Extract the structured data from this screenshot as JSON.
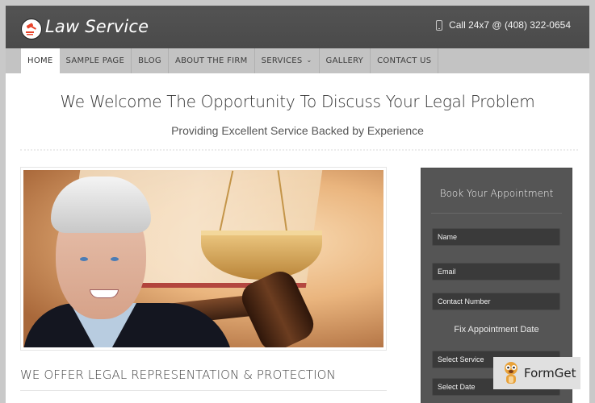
{
  "header": {
    "logo_icon": "gavel-icon",
    "site_title": "Law Service",
    "phone_icon": "mobile-phone-icon",
    "phone_text": "Call 24x7 @ (408) 322-0654"
  },
  "nav": {
    "items": [
      {
        "label": "HOME",
        "active": true
      },
      {
        "label": "SAMPLE PAGE"
      },
      {
        "label": "BLOG"
      },
      {
        "label": "ABOUT THE FIRM"
      },
      {
        "label": "SERVICES",
        "dropdown": true
      },
      {
        "label": "GALLERY"
      },
      {
        "label": "CONTACT US"
      }
    ]
  },
  "main": {
    "headline": "We Welcome The Opportunity To Discuss Your Legal Problem",
    "subheadline": "Providing Excellent Service Backed by Experience",
    "hero_image": "lawyer-with-scales-and-gavel",
    "section_title": "WE OFFER LEGAL REPRESENTATION & PROTECTION"
  },
  "appointment": {
    "title": "Book Your Appointment",
    "fields": {
      "name": "Name",
      "email": "Email",
      "contact": "Contact Number"
    },
    "date_heading": "Fix Appointment Date",
    "select_service": "Select Service",
    "select_date": "Select Date"
  },
  "watermark": {
    "icon": "formget-mascot-icon",
    "text": "FormGet"
  },
  "colors": {
    "header_bg": "#4e4e4e",
    "nav_bg": "#c3c3c3",
    "sidebar_bg": "#555555",
    "field_bg": "#3a3a3a",
    "logo_accent": "#e8452c"
  }
}
